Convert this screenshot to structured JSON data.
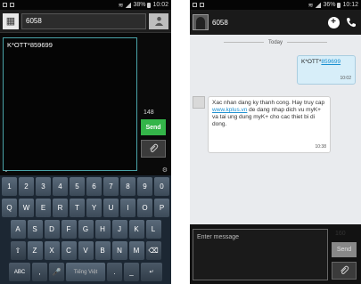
{
  "left": {
    "status_time": "10:02",
    "battery": "38%",
    "recipient": "6058",
    "compose_text": "K*OTT*859699",
    "counter": "148",
    "send_label": "Send",
    "keyboard": {
      "row1": [
        "1",
        "2",
        "3",
        "4",
        "5",
        "6",
        "7",
        "8",
        "9",
        "0"
      ],
      "row2": [
        "Q",
        "W",
        "E",
        "R",
        "T",
        "Y",
        "U",
        "I",
        "O",
        "P"
      ],
      "row3": [
        "A",
        "S",
        "D",
        "F",
        "G",
        "H",
        "J",
        "K",
        "L"
      ],
      "row4": [
        "Z",
        "X",
        "C",
        "V",
        "B",
        "N",
        "M"
      ],
      "abc_label": "ABC",
      "space_label": "Tiếng Việt"
    }
  },
  "right": {
    "status_time": "10:12",
    "battery": "36%",
    "recipient": "6058",
    "date_divider": "Today",
    "outgoing": {
      "prefix": "K*OTT*",
      "code": "859699",
      "time": "10:02"
    },
    "incoming": {
      "pre": "Xac nhan dang ky thanh cong. Hay truy cap ",
      "link": "www.kplus.vn",
      "post": " de dang nhap dich vu myK+ va tai ung dung myK+ cho cac thiet bi di dong.",
      "time": "10:38"
    },
    "input_placeholder": "Enter message",
    "counter": "160",
    "send_label": "Send"
  },
  "icons": [
    "contact-card-icon",
    "person-icon",
    "paperclip-icon",
    "add-icon",
    "phone-icon",
    "settings-icon",
    "backspace-icon",
    "enter-icon"
  ]
}
